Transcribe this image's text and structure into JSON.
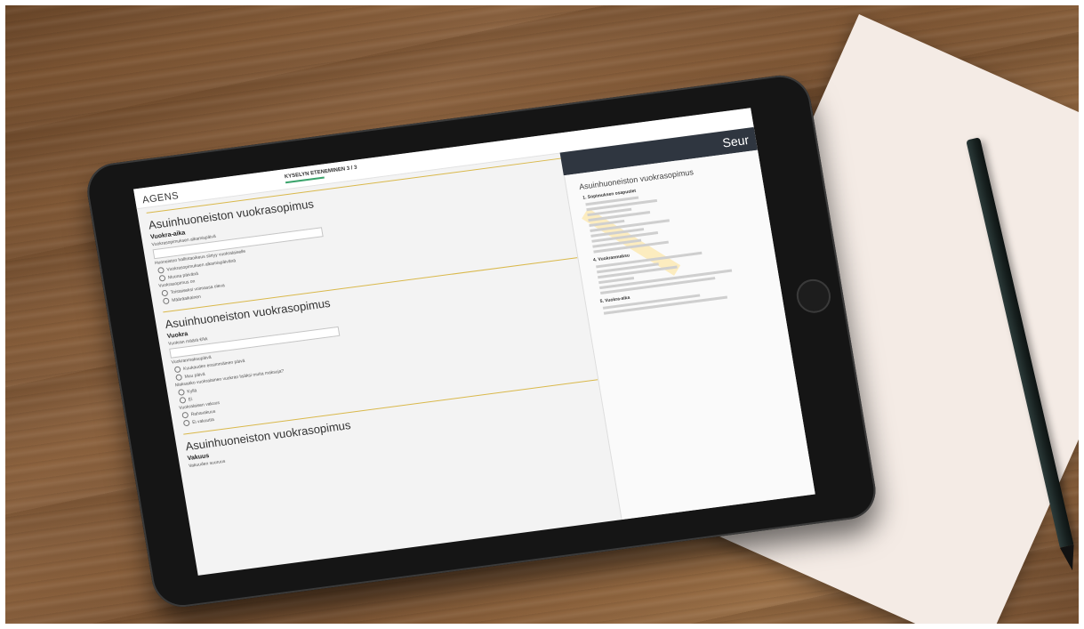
{
  "app": {
    "logo": "AGENS",
    "progress_label": "KYSELYN ETENEMINEN 3 / 3"
  },
  "next_button": {
    "label": "Seur"
  },
  "form": {
    "sections": [
      {
        "title": "Asuinhuoneiston vuokrasopimus",
        "subtitle": "Vuokra-aika",
        "question1": "Vuokrasopimuksen alkamispäivä",
        "question2": "Huoneiston hallintaoikeus siirtyy vuokralaiselle",
        "option1": "Vuokrasopimuksen alkamispäivänä",
        "option2": "Muuna päivänä",
        "question3": "Vuokrasopimus on",
        "option3": "Toistaiseksi voimassa oleva",
        "option4": "Määräaikainen"
      },
      {
        "title": "Asuinhuoneiston vuokrasopimus",
        "subtitle": "Vuokra",
        "question1": "Vuokran määrä €/kk",
        "question2": "Vuokranmaksupäivä",
        "option1": "Kuukauden ensimmäinen päivä",
        "option2": "Muu päivä",
        "question3": "Maksaako vuokralainen vuokran lisäksi muita maksuja?",
        "option3": "Kyllä",
        "option4": "Ei",
        "question4": "Vuokralaisen vakuus",
        "option5": "Rahavakuus",
        "option6": "Ei vakuutta"
      },
      {
        "title": "Asuinhuoneiston vuokrasopimus",
        "subtitle": "Vakuus",
        "question1": "Vakuuden suuruus"
      }
    ]
  },
  "preview": {
    "title": "Asuinhuoneiston vuokrasopimus",
    "heading1": "1. Sopimuksen osapuolet",
    "heading2": "4. Vuokranmaksu",
    "heading3": "5. Vuokra-aika"
  }
}
